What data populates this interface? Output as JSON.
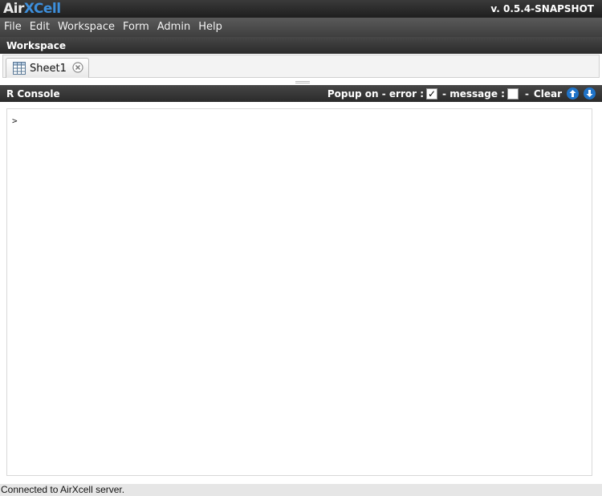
{
  "app": {
    "logo_part1": "Air",
    "logo_part2": "XCell",
    "version": "v. 0.5.4-SNAPSHOT"
  },
  "menu": [
    "File",
    "Edit",
    "Workspace",
    "Form",
    "Admin",
    "Help"
  ],
  "workspace": {
    "title": "Workspace",
    "tabs": [
      {
        "label": "Sheet1"
      }
    ]
  },
  "console": {
    "title": "R Console",
    "popup_label": "Popup on - error :",
    "error_checked": true,
    "message_label": "- message :",
    "message_checked": false,
    "clear_sep": "-",
    "clear_label": "Clear",
    "prompt": ">"
  },
  "status": "Connected to AirXcell server.",
  "colors": {
    "accent_blue": "#1f73c8",
    "logo_blue": "#3d8fdc",
    "header_dark": "#2a2a2a"
  }
}
